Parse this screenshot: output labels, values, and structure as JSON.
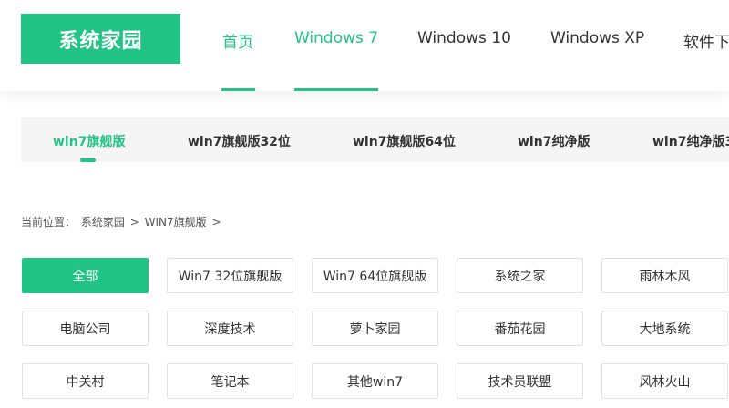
{
  "header": {
    "logo_text": "系统家园",
    "nav": [
      {
        "label": "首页",
        "active": true
      },
      {
        "label": "Windows 7",
        "active": true
      },
      {
        "label": "Windows 10",
        "active": false
      },
      {
        "label": "Windows XP",
        "active": false
      },
      {
        "label": "软件下",
        "active": false
      }
    ]
  },
  "subnav": {
    "items": [
      {
        "label": "win7旗舰版",
        "active": true
      },
      {
        "label": "win7旗舰版32位",
        "active": false
      },
      {
        "label": "win7旗舰版64位",
        "active": false
      },
      {
        "label": "win7纯净版",
        "active": false
      },
      {
        "label": "win7纯净版3",
        "active": false
      }
    ]
  },
  "breadcrumb": {
    "prefix": "当前位置：",
    "items": [
      "系统家园",
      "WIN7旗舰版"
    ],
    "separator": ">"
  },
  "filters": {
    "rows": [
      [
        "全部",
        "Win7 32位旗舰版",
        "Win7 64位旗舰版",
        "系统之家",
        "雨林木风"
      ],
      [
        "电脑公司",
        "深度技术",
        "萝卜家园",
        "番茄花园",
        "大地系统"
      ],
      [
        "中关村",
        "笔记本",
        "其他win7",
        "技术员联盟",
        "风林火山"
      ]
    ],
    "selected": "全部"
  },
  "colors": {
    "accent": "#22c486",
    "subnav_bg": "#f5f5f5",
    "border": "#e2e2e2"
  }
}
